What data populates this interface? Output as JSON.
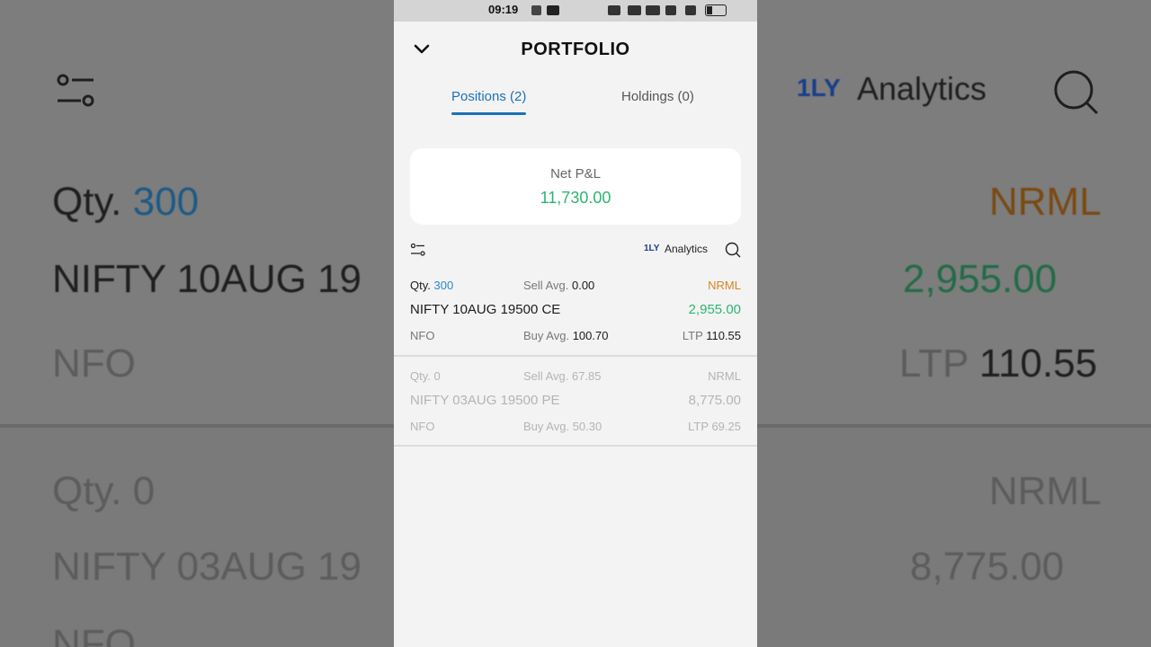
{
  "status_bar": {
    "time": "09:19"
  },
  "header": {
    "title": "PORTFOLIO",
    "back_icon": "chevron-down-icon"
  },
  "tabs": [
    {
      "label": "Positions (2)",
      "active": true
    },
    {
      "label": "Holdings (0)",
      "active": false
    }
  ],
  "net_pnl": {
    "label": "Net P&L",
    "value": "11,730.00"
  },
  "toolbar": {
    "logo": "1LY",
    "analytics_label": "Analytics"
  },
  "positions": [
    {
      "qty_label": "Qty.",
      "qty": "300",
      "sell_label": "Sell Avg.",
      "sell_avg": "0.00",
      "product": "NRML",
      "symbol": "NIFTY 10AUG 19500 CE",
      "pnl": "2,955.00",
      "exchange": "NFO",
      "buy_label": "Buy Avg.",
      "buy_avg": "100.70",
      "ltp_label": "LTP",
      "ltp": "110.55"
    },
    {
      "qty_label": "Qty.",
      "qty": "0",
      "sell_label": "Sell Avg.",
      "sell_avg": "67.85",
      "product": "NRML",
      "symbol": "NIFTY 03AUG 19500 PE",
      "pnl": "8,775.00",
      "exchange": "NFO",
      "buy_label": "Buy Avg.",
      "buy_avg": "50.30",
      "ltp_label": "LTP",
      "ltp": "69.25"
    }
  ],
  "colors": {
    "accent": "#1a73b8",
    "profit": "#2bb673",
    "product": "#d98324"
  }
}
